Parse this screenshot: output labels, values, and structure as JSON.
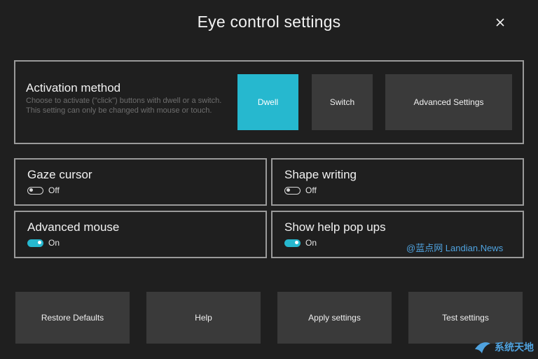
{
  "window": {
    "title": "Eye control settings",
    "close_icon": "close-icon"
  },
  "activation": {
    "heading": "Activation method",
    "description": "Choose to activate (\"click\") buttons with dwell or a switch. This setting can only be changed with mouse or touch.",
    "options": {
      "dwell": "Dwell",
      "switch": "Switch",
      "advanced": "Advanced Settings"
    },
    "selected": "Dwell"
  },
  "toggles": {
    "gaze_cursor": {
      "label": "Gaze cursor",
      "state": "Off"
    },
    "shape_writing": {
      "label": "Shape writing",
      "state": "Off"
    },
    "advanced_mouse": {
      "label": "Advanced mouse",
      "state": "On"
    },
    "help_popups": {
      "label": "Show help pop ups",
      "state": "On"
    }
  },
  "watermark": "@蓝点网 Landian.News",
  "footer": {
    "restore": "Restore Defaults",
    "help": "Help",
    "apply": "Apply settings",
    "test": "Test settings"
  },
  "corner_logo": "系统天地",
  "colors": {
    "background": "#1f1f1f",
    "accent": "#26b8cf",
    "button": "#3a3a3a",
    "border": "#9a9a9a",
    "watermark": "#4fa3e0"
  }
}
